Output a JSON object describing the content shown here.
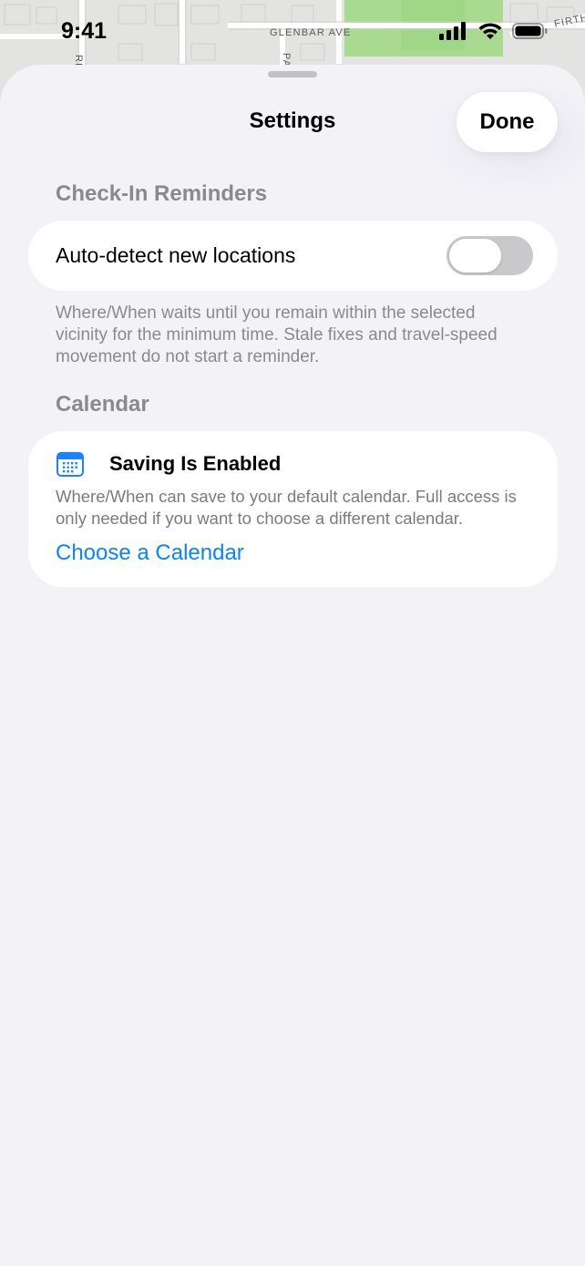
{
  "map": {
    "street_1": "GLENBAR AVE",
    "street_2": "FIRTH",
    "street_3": "RRE",
    "street_4": "PA",
    "land_color": "#e3e3e1",
    "park_color": "#a8db8f"
  },
  "status_bar": {
    "time": "9:41",
    "signal_icon": "cellular-signal-icon",
    "wifi_icon": "wifi-icon",
    "battery_icon": "battery-icon"
  },
  "sheet": {
    "title": "Settings",
    "done_label": "Done",
    "background": "#f2f2f7"
  },
  "checkin": {
    "header": "Check-In Reminders",
    "auto_detect_label": "Auto-detect new locations",
    "auto_detect_on": false,
    "footnote": "Where/When waits until you remain within the selected vicinity for the minimum time. Stale fixes and travel-speed movement do not start a reminder."
  },
  "calendar": {
    "header": "Calendar",
    "icon": "calendar-icon",
    "status_title": "Saving Is Enabled",
    "description": "Where/When can save to your default calendar. Full access is only needed if you want to choose a different calendar.",
    "choose_link": "Choose a Calendar",
    "accent_color": "#0a84ff"
  }
}
